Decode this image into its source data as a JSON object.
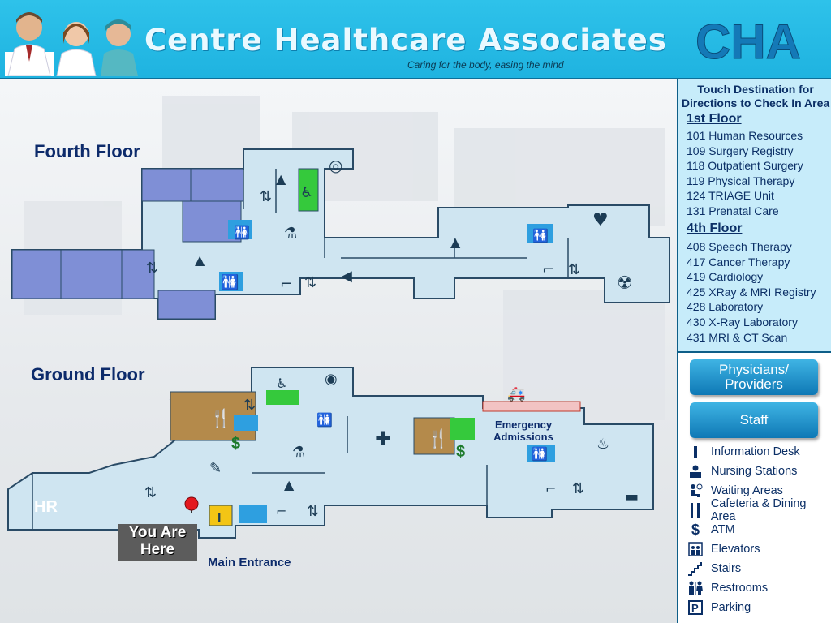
{
  "header": {
    "title": "Centre Healthcare Associates",
    "tagline": "Caring for the body, easing the mind",
    "logo_text": "CHA"
  },
  "map": {
    "fourth_floor_label": "Fourth Floor",
    "ground_floor_label": "Ground Floor",
    "hr_label": "HR",
    "emergency_label_1": "Emergency",
    "emergency_label_2": "Admissions",
    "you_are_here_1": "You Are",
    "you_are_here_2": "Here",
    "main_entrance": "Main Entrance",
    "info_marker": "I",
    "atm_marker": "$"
  },
  "panel": {
    "heading_1": "Touch Destination for",
    "heading_2": "Directions to Check In Area",
    "floor1_title": "1st Floor",
    "floor1_rooms": [
      "101 Human Resources",
      "109 Surgery Registry",
      "118 Outpatient Surgery",
      "119 Physical Therapy",
      "124 TRIAGE Unit",
      "131 Prenatal Care"
    ],
    "floor4_title": "4th Floor",
    "floor4_rooms": [
      "408 Speech Therapy",
      "417 Cancer Therapy",
      "419 Cardiology",
      "425 XRay & MRI Registry",
      "428 Laboratory",
      "430 X-Ray Laboratory",
      "431 MRI & CT Scan"
    ],
    "physicians_button": "Physicians/ Providers",
    "staff_button": "Staff",
    "legend": [
      {
        "icon": "info-desk-icon",
        "label": "Information Desk"
      },
      {
        "icon": "nursing-station-icon",
        "label": "Nursing Stations"
      },
      {
        "icon": "waiting-area-icon",
        "label": "Waiting Areas"
      },
      {
        "icon": "cafeteria-icon",
        "label": "Cafeteria & Dining Area"
      },
      {
        "icon": "atm-icon",
        "label": "ATM"
      },
      {
        "icon": "elevator-icon",
        "label": "Elevators"
      },
      {
        "icon": "stairs-icon",
        "label": "Stairs"
      },
      {
        "icon": "restroom-icon",
        "label": "Restrooms"
      },
      {
        "icon": "parking-icon",
        "label": "Parking"
      }
    ]
  },
  "colors": {
    "header": "#22b8e4",
    "floor": "#cfe5f1",
    "wall": "#1c3c55",
    "offices": "#7f8fd6",
    "restroom": "#2e9fe0",
    "waiting": "#35c93c",
    "cafeteria": "#b48a4b",
    "atm": "#1d7a2c"
  }
}
